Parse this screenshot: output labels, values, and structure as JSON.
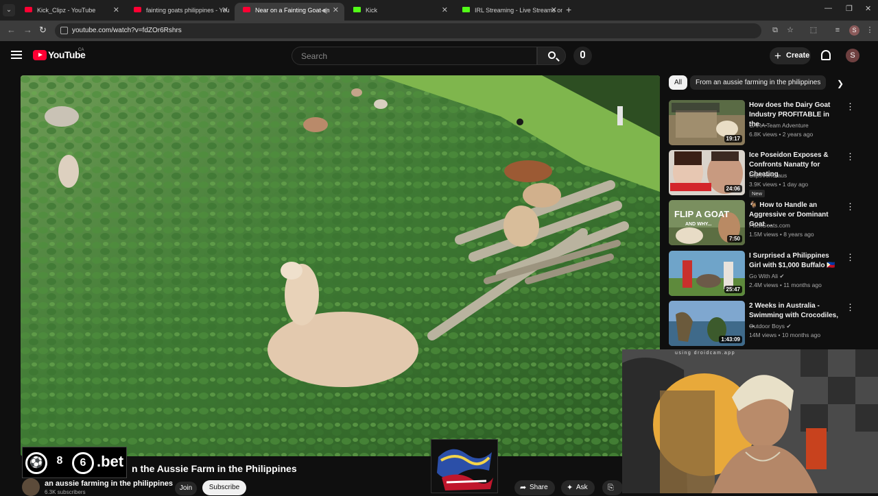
{
  "browser": {
    "tabs": [
      {
        "title": "Kick_Clipz - YouTube",
        "favicon": "youtube-favicon",
        "active": false
      },
      {
        "title": "fainting goats philippines - You",
        "favicon": "youtube-favicon",
        "active": false
      },
      {
        "title": "Near on a Fainting Goat on",
        "favicon": "youtube-favicon",
        "active": true
      },
      {
        "title": "Kick",
        "favicon": "kick-favicon",
        "active": false
      },
      {
        "title": "IRL Streaming - Live Streams on",
        "favicon": "kick-favicon",
        "active": false
      }
    ],
    "url": "youtube.com/watch?v=fdZOr6Rshrs",
    "profile_initial": "S"
  },
  "header": {
    "logo_text": "YouTube",
    "region": "CA",
    "search_placeholder": "Search",
    "create_label": "Create",
    "avatar_initial": "S"
  },
  "video": {
    "title_visible": "n the Aussie Farm in the Philippines",
    "channel": "an aussie farming in the philippines",
    "subscribers_partial": "6.3K subscribers",
    "join_label": "Join",
    "subscribe_label": "Subscribe",
    "share_label": "Share",
    "ask_label": "Ask"
  },
  "overlays": {
    "sponsor_digit_1": "8",
    "sponsor_digit_2": "6",
    "sponsor_suffix": ".bet",
    "webcam_caption": "using droidcam.app"
  },
  "chips": [
    {
      "label": "All",
      "active": true
    },
    {
      "label": "From an aussie farming in the philippines",
      "active": false
    }
  ],
  "recommendations": [
    {
      "title": "How does the Dairy Goat Industry PROFITABLE in the ...",
      "channel": "CARA Team Adventure",
      "meta": "6.8K views • 2 years ago",
      "duration": "19:17",
      "badge": ""
    },
    {
      "title": "Ice Poseidon Exposes & Confronts Nanatty for Cheating",
      "channel": "ClipsVonClaus",
      "meta": "3.9K views • 1 day ago",
      "duration": "24:06",
      "badge": "New"
    },
    {
      "title": "🐐 How to Handle an Aggressive or Dominant Goat ...",
      "channel": "PackGoats.com",
      "meta": "1.5M views • 8 years ago",
      "duration": "7:50",
      "badge": ""
    },
    {
      "title": "I Surprised a Philippines Girl with $1,000 Buffalo 🇵🇭",
      "channel": "Go With Ali ✔",
      "meta": "2.4M views • 11 months ago",
      "duration": "25:47",
      "badge": ""
    },
    {
      "title": "2 Weeks in Australia - Swimming with Crocodiles, ...",
      "channel": "Outdoor Boys ✔",
      "meta": "14M views • 10 months ago",
      "duration": "1:43:09",
      "badge": ""
    }
  ],
  "thumb_text": {
    "flip_a_goat": "FLIP A GOAT",
    "and_why": "AND WHY..."
  },
  "colors": {
    "brand_red": "#ff0033",
    "kick_green": "#53fc18",
    "background": "#0f0f0f"
  }
}
